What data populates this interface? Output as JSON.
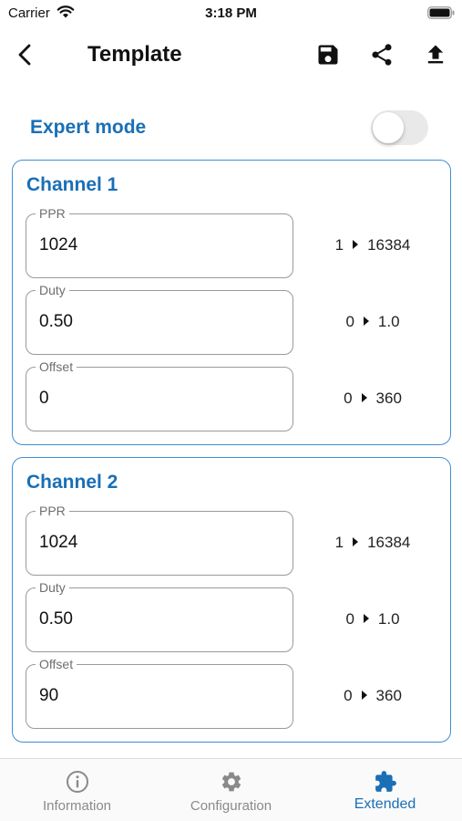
{
  "status_bar": {
    "carrier": "Carrier",
    "time": "3:18 PM"
  },
  "nav": {
    "title": "Template",
    "icons": [
      "back-icon",
      "save-icon",
      "share-icon",
      "upload-icon"
    ]
  },
  "expert_mode": {
    "label": "Expert mode",
    "enabled": false
  },
  "channels": [
    {
      "title": "Channel 1",
      "fields": [
        {
          "label": "PPR",
          "value": "1024",
          "min": "1",
          "max": "16384"
        },
        {
          "label": "Duty",
          "value": "0.50",
          "min": "0",
          "max": "1.0"
        },
        {
          "label": "Offset",
          "value": "0",
          "min": "0",
          "max": "360"
        }
      ]
    },
    {
      "title": "Channel 2",
      "fields": [
        {
          "label": "PPR",
          "value": "1024",
          "min": "1",
          "max": "16384"
        },
        {
          "label": "Duty",
          "value": "0.50",
          "min": "0",
          "max": "1.0"
        },
        {
          "label": "Offset",
          "value": "90",
          "min": "0",
          "max": "360"
        }
      ]
    }
  ],
  "tabs": [
    {
      "label": "Information",
      "icon": "info-icon",
      "active": false
    },
    {
      "label": "Configuration",
      "icon": "gear-icon",
      "active": false
    },
    {
      "label": "Extended",
      "icon": "puzzle-icon",
      "active": true
    }
  ],
  "colors": {
    "accent": "#1a6fb5",
    "card_border": "#3f8ed3",
    "inactive": "#8a8a8a"
  }
}
